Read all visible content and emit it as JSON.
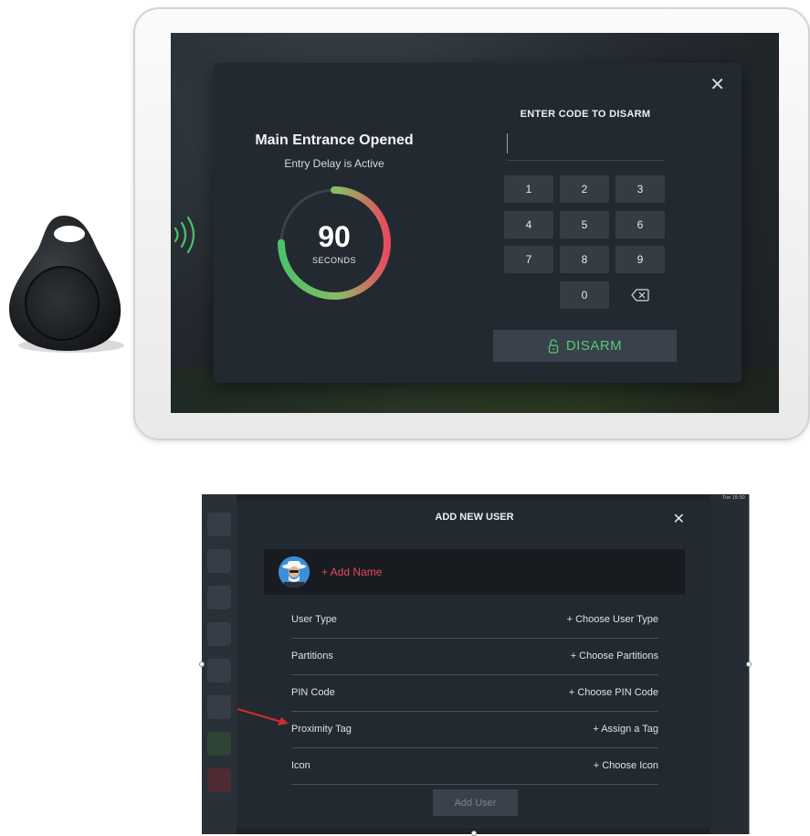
{
  "disarm_panel": {
    "alert_title": "Main Entrance Opened",
    "alert_subtitle": "Entry Delay is Active",
    "timer_value": "90",
    "timer_unit": "SECONDS",
    "timer_remaining_fraction": 0.75,
    "code_prompt": "ENTER CODE TO DISARM",
    "keypad": [
      "1",
      "2",
      "3",
      "4",
      "5",
      "6",
      "7",
      "8",
      "9",
      "0"
    ],
    "disarm_label": "DISARM",
    "icons": [
      "close-icon",
      "backspace-icon",
      "unlock-icon",
      "rfid-waves-icon"
    ],
    "colors": {
      "accent_green": "#57c874",
      "alert_red": "#e84a5f",
      "panel_bg": "#232930"
    }
  },
  "add_user": {
    "status_time": "Tue 15:50",
    "title": "ADD NEW USER",
    "add_name": "+ Add Name",
    "fields": [
      {
        "label": "User Type",
        "value": "+ Choose User Type"
      },
      {
        "label": "Partitions",
        "value": "+ Choose Partitions"
      },
      {
        "label": "PIN Code",
        "value": "+ Choose PIN Code"
      },
      {
        "label": "Proximity Tag",
        "value": "+ Assign a Tag"
      },
      {
        "label": "Icon",
        "value": "+ Choose Icon"
      }
    ],
    "add_user_label": "Add User",
    "colors": {
      "name_red": "#e5485e",
      "arrow_red": "#d42a2a"
    }
  }
}
